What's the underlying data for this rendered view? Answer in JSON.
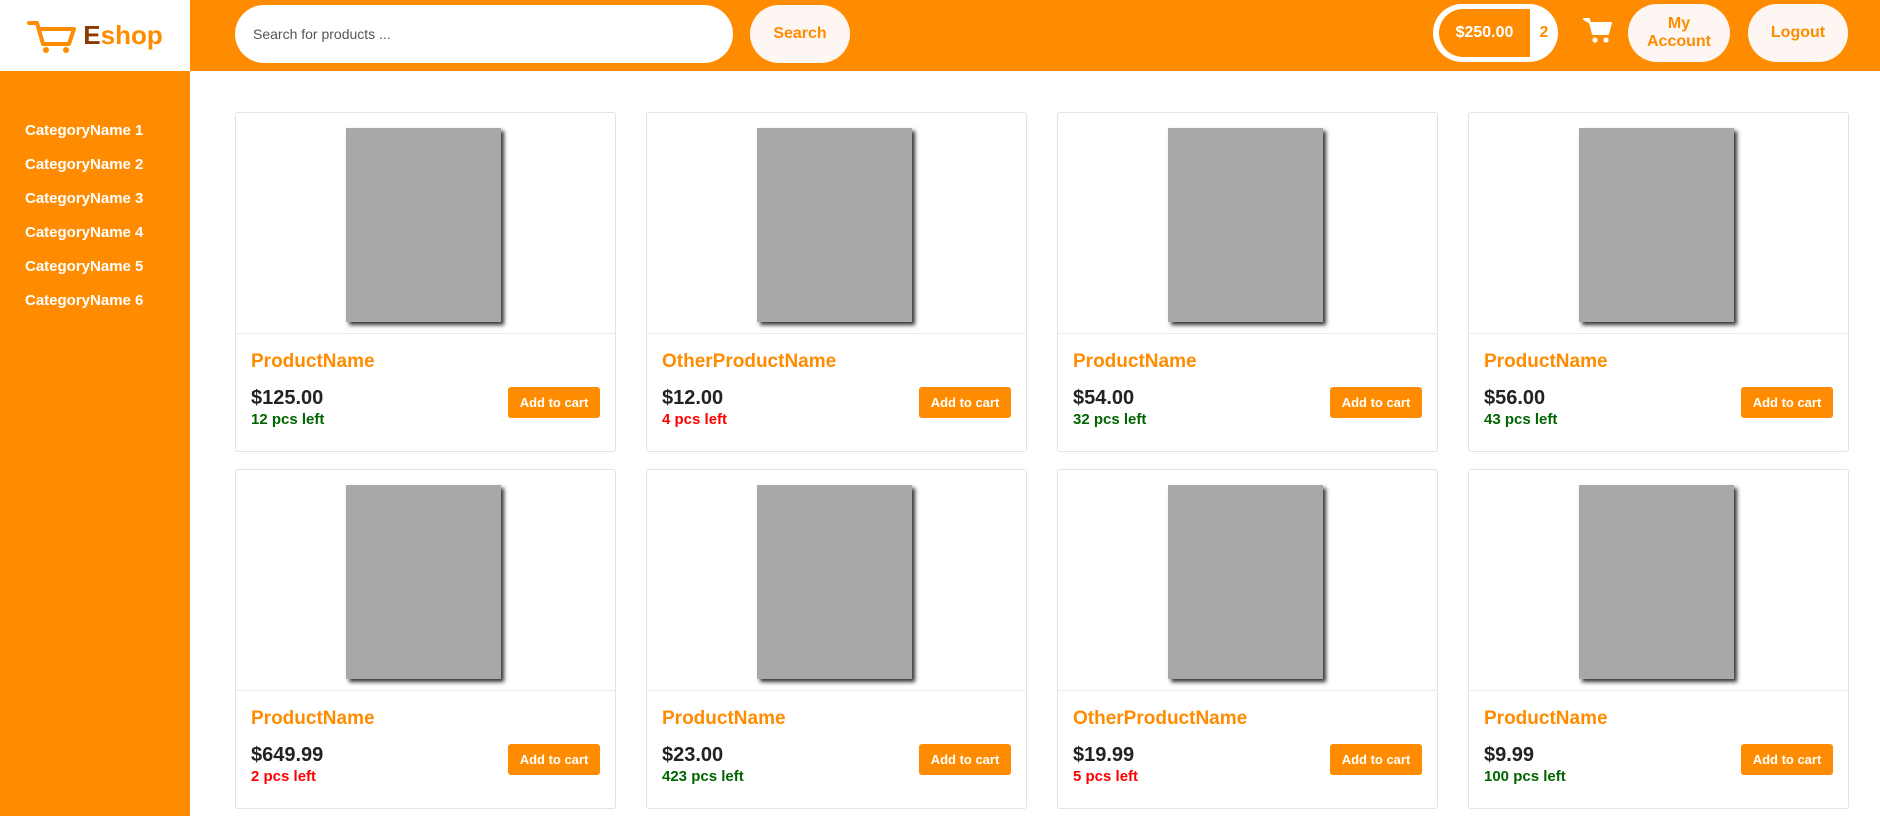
{
  "logo": {
    "text_first": "E",
    "text_rest": "shop"
  },
  "search": {
    "placeholder": "Search for products ...",
    "value": "",
    "button_label": "Search"
  },
  "cart": {
    "total": "$250.00",
    "count": "2"
  },
  "account": {
    "my_account_label": "My Account",
    "logout_label": "Logout"
  },
  "colors": {
    "accent": "#ff8c00",
    "stock_ok": "#006400",
    "stock_low": "#ff0000",
    "placeholder_image": "#a8a8a8"
  },
  "sidebar": {
    "items": [
      {
        "label": "CategoryName 1"
      },
      {
        "label": "CategoryName 2"
      },
      {
        "label": "CategoryName 3"
      },
      {
        "label": "CategoryName 4"
      },
      {
        "label": "CategoryName 5"
      },
      {
        "label": "CategoryName 6"
      }
    ]
  },
  "products": [
    {
      "name": "ProductName",
      "price": "$125.00",
      "stock": "12 pcs left",
      "stock_status": "ok",
      "button": "Add to cart"
    },
    {
      "name": "OtherProductName",
      "price": "$12.00",
      "stock": "4 pcs left",
      "stock_status": "low",
      "button": "Add to cart"
    },
    {
      "name": "ProductName",
      "price": "$54.00",
      "stock": "32 pcs left",
      "stock_status": "ok",
      "button": "Add to cart"
    },
    {
      "name": "ProductName",
      "price": "$56.00",
      "stock": "43 pcs left",
      "stock_status": "ok",
      "button": "Add to cart"
    },
    {
      "name": "ProductName",
      "price": "$649.99",
      "stock": "2 pcs left",
      "stock_status": "low",
      "button": "Add to cart"
    },
    {
      "name": "ProductName",
      "price": "$23.00",
      "stock": "423 pcs left",
      "stock_status": "ok",
      "button": "Add to cart"
    },
    {
      "name": "OtherProductName",
      "price": "$19.99",
      "stock": "5 pcs left",
      "stock_status": "low",
      "button": "Add to cart"
    },
    {
      "name": "ProductName",
      "price": "$9.99",
      "stock": "100 pcs left",
      "stock_status": "ok",
      "button": "Add to cart"
    }
  ]
}
